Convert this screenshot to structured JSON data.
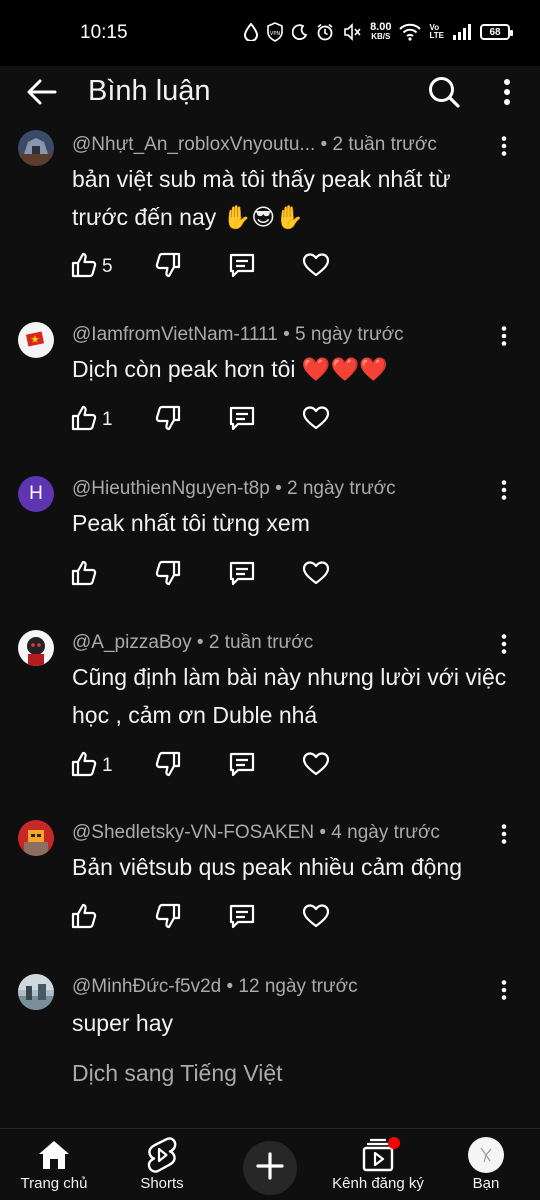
{
  "status_bar": {
    "time": "10:15",
    "net_speed_value": "8.00",
    "net_speed_unit": "KB/S",
    "volte_top": "Vo",
    "volte_bottom": "LTE",
    "battery": "68",
    "icons": [
      "drop-icon",
      "vpn-icon",
      "moon-icon",
      "alarm-icon",
      "mute-icon",
      "wifi-icon",
      "signal-icon",
      "battery-icon"
    ]
  },
  "header": {
    "title": "Bình luận",
    "icons": [
      "back-arrow-icon",
      "search-icon",
      "kebab-menu-icon"
    ]
  },
  "comments": [
    {
      "author": "@Nhựt_An_robloxVnyoutu...",
      "time": " • 2 tuần trước",
      "text": "bản việt sub mà tôi thấy peak nhất từ trước đến nay ✋😎✋",
      "likes": "5"
    },
    {
      "author": "@IamfromVietNam-1111",
      "time": " • 5 ngày trước",
      "text": "Dịch còn peak hơn tôi ❤️❤️❤️",
      "likes": "1"
    },
    {
      "author": "@HieuthienNguyen-t8p",
      "time": " • 2 ngày trước",
      "text": "Peak nhất tôi từng xem",
      "likes": "",
      "avatar_letter": "H"
    },
    {
      "author": "@A_pizzaBoy",
      "time": " • 2 tuần trước",
      "text": "Cũng định làm bài này nhưng lười với việc học ,  cảm ơn Duble nhá",
      "likes": "1"
    },
    {
      "author": "@Shedletsky-VN-FOSAKEN",
      "time": " • 4 ngày trước",
      "text": "Bản viêtsub qus peak nhiều cảm động",
      "likes": ""
    },
    {
      "author": "@MinhĐức-f5v2d",
      "time": " • 12 ngày trước",
      "text": "super hay",
      "translate": "Dịch sang Tiếng Việt"
    }
  ],
  "bottom_nav": {
    "home": "Trang chủ",
    "shorts": "Shorts",
    "subscriptions": "Kênh đăng ký",
    "you": "Bạn"
  },
  "colors": {
    "background": "#0f0f0f",
    "text_primary": "#f1f1f1",
    "text_secondary": "#aaaaaa",
    "notification_dot": "#ff0000",
    "avatar_h_bg": "#5e35b1"
  }
}
